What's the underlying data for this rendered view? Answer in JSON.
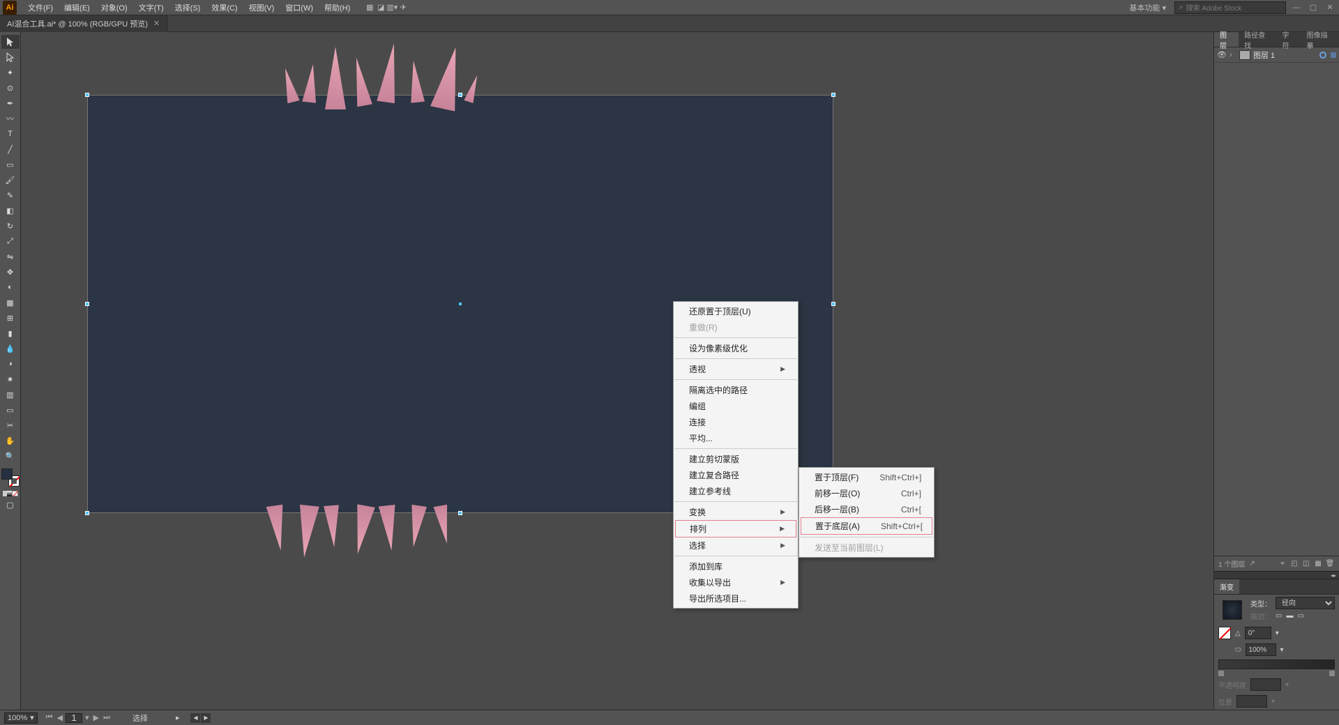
{
  "app_icon": "Ai",
  "menu": [
    "文件(F)",
    "编辑(E)",
    "对象(O)",
    "文字(T)",
    "选择(S)",
    "效果(C)",
    "视图(V)",
    "窗口(W)",
    "帮助(H)"
  ],
  "workspace": "基本功能",
  "search_placeholder": "搜索 Adobe Stock",
  "doc_tab": "AI混合工具.ai* @ 100% (RGB/GPU 预览)",
  "ctx1": {
    "undo": "还原置于顶层(U)",
    "redo": "重做(R)",
    "pixel_opt": "设为像素级优化",
    "perspective": "透视",
    "isolate": "隔离选中的路径",
    "ungroup": "编组",
    "join": "连接",
    "average": "平均...",
    "clip": "建立剪切蒙版",
    "compound": "建立复合路径",
    "guide": "建立参考线",
    "transform": "变换",
    "arrange": "排列",
    "select": "选择",
    "add_lib": "添加到库",
    "collect_export": "收集以导出",
    "export_sel": "导出所选项目..."
  },
  "ctx2": {
    "front": {
      "label": "置于顶层(F)",
      "sc": "Shift+Ctrl+]"
    },
    "fwd": {
      "label": "前移一层(O)",
      "sc": "Ctrl+]"
    },
    "back": {
      "label": "后移一层(B)",
      "sc": "Ctrl+["
    },
    "bottom": {
      "label": "置于底层(A)",
      "sc": "Shift+Ctrl+["
    },
    "send_layer": "发送至当前图层(L)"
  },
  "panels": {
    "tabs1": [
      "图层",
      "路径查找",
      "字符",
      "图像描摹"
    ],
    "layer1": "图层 1",
    "layer_count": "1 个图层",
    "tabs2": [
      "渐变"
    ],
    "grad": {
      "type_lbl": "类型：",
      "type_val": "径向",
      "stroke_lbl": "描边：",
      "angle": "0°",
      "opacity": "100%",
      "opacity_lbl": "不透明度",
      "pos_lbl": "位置"
    }
  },
  "status": {
    "zoom": "100%",
    "page": "1",
    "tool": "选择"
  }
}
